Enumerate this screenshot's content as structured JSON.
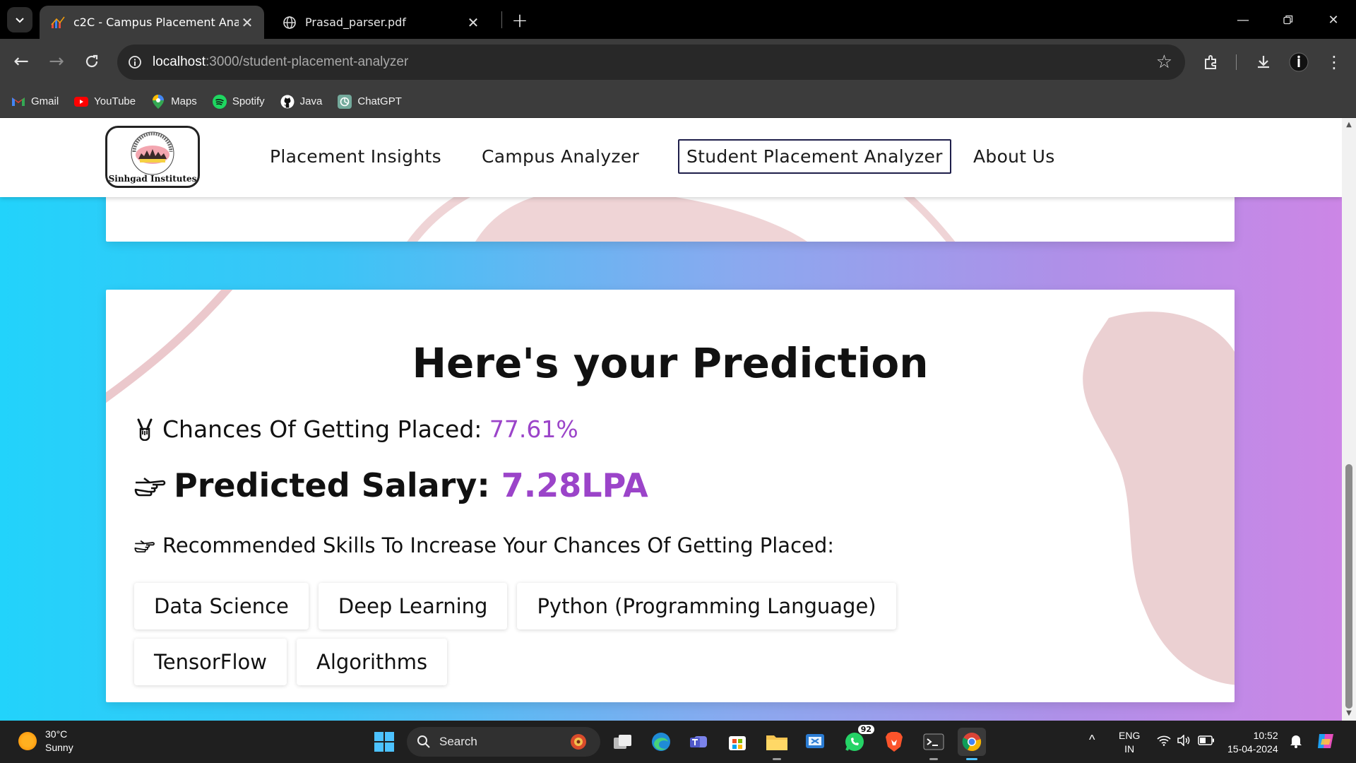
{
  "browser": {
    "tabs": [
      {
        "title": "c2C - Campus Placement Analyzer",
        "active": true
      },
      {
        "title": "Prasad_parser.pdf",
        "active": false
      }
    ],
    "url_host": "localhost",
    "url_rest": ":3000/student-placement-analyzer",
    "bookmarks": [
      {
        "label": "Gmail",
        "icon": "gmail-icon"
      },
      {
        "label": "YouTube",
        "icon": "youtube-icon"
      },
      {
        "label": "Maps",
        "icon": "maps-icon"
      },
      {
        "label": "Spotify",
        "icon": "spotify-icon"
      },
      {
        "label": "Java",
        "icon": "github-icon"
      },
      {
        "label": "ChatGPT",
        "icon": "chatgpt-icon"
      }
    ]
  },
  "site": {
    "logo_text": "Sinhgad Institutes",
    "nav": [
      {
        "label": "Placement Insights"
      },
      {
        "label": "Campus Analyzer"
      },
      {
        "label": "Student Placement Analyzer",
        "active": true
      },
      {
        "label": "About Us"
      }
    ]
  },
  "prediction": {
    "title": "Here's your Prediction",
    "chance_label": "Chances Of Getting Placed",
    "chance_value": "77.61%",
    "salary_label": "Predicted Salary",
    "salary_value": "7.28LPA",
    "skills_label": "Recommended Skills To Increase Your Chances Of Getting Placed",
    "skills": [
      "Data Science",
      "Deep Learning",
      "Python (Programming Language)",
      "TensorFlow",
      "Algorithms"
    ],
    "accent_color": "#9b44c9"
  },
  "taskbar": {
    "weather_temp": "30°C",
    "weather_desc": "Sunny",
    "search_placeholder": "Search",
    "whatsapp_badge": "92",
    "lang_top": "ENG",
    "lang_bottom": "IN",
    "time": "10:52",
    "date": "15-04-2024"
  }
}
